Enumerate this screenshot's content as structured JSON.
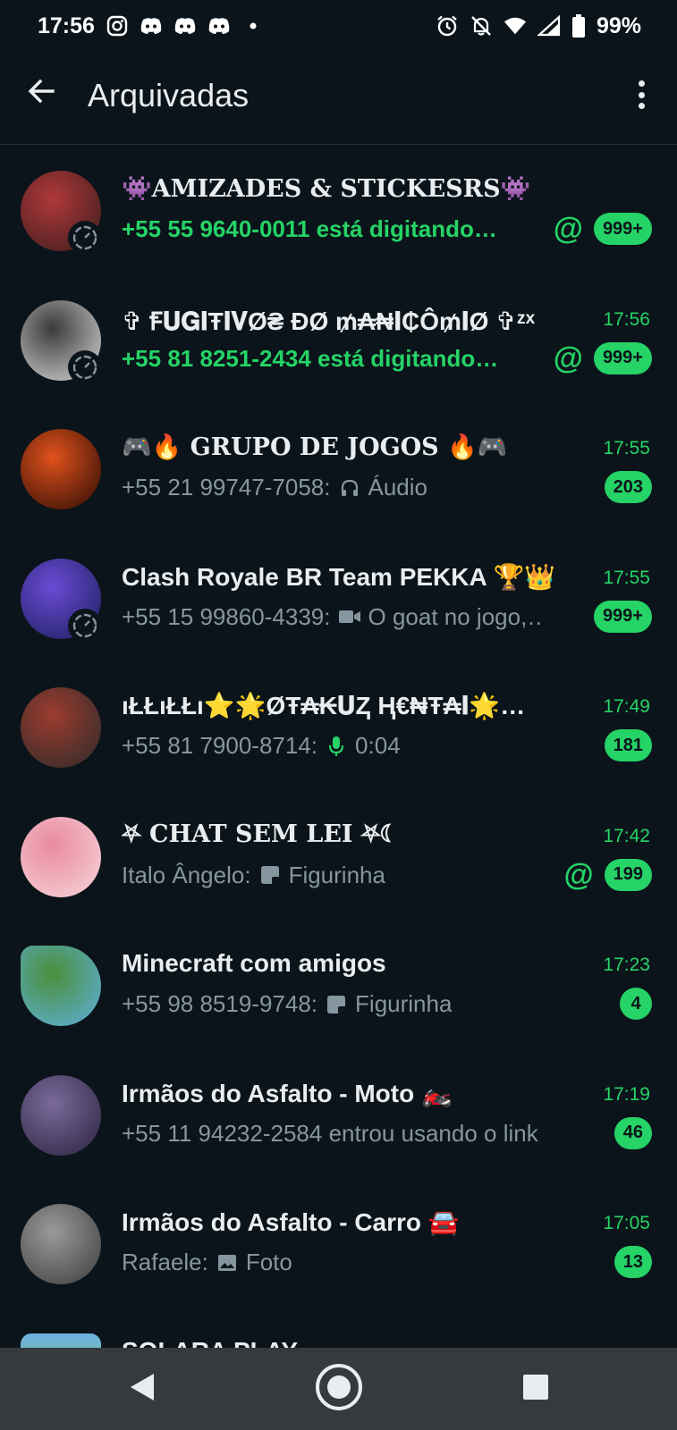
{
  "status_bar": {
    "time": "17:56",
    "battery": "99%",
    "left_icons": [
      "instagram-icon",
      "discord-icon",
      "discord-icon",
      "discord-icon",
      "dot-icon"
    ],
    "right_icons": [
      "alarm-icon",
      "bell-off-icon",
      "wifi-icon",
      "signal-icon",
      "battery-icon"
    ]
  },
  "app_bar": {
    "title": "Arquivadas",
    "back_icon": "arrow-left-icon",
    "menu_icon": "more-vertical-icon"
  },
  "colors": {
    "background": "#0b141a",
    "accent": "#25d366",
    "text_primary": "#e9edef",
    "text_secondary": "#8696a0",
    "nav_bar": "#373a3d"
  },
  "chats": [
    {
      "title": "👾AMIZADES & STICKESRS👾",
      "time": "",
      "preview_prefix": "",
      "preview_icon": "",
      "preview": "+55 55 9640-0011 está digitando…",
      "typing": true,
      "mention": true,
      "unread": "999+",
      "status_ring": true,
      "avatar_colors": [
        "#3a1d1d",
        "#b0383a"
      ]
    },
    {
      "title": "✞ Ꞙ𝐔𝐆𝐈Ŧ𝐈𝐕Ø₴ ĐØ ₥₳₦𝐈₵Ô₥𝐈Ø ✞ᶻˣ",
      "time": "17:56",
      "preview_prefix": "",
      "preview_icon": "",
      "preview": "+55 81 8251-2434 está digitando…",
      "typing": true,
      "mention": true,
      "unread": "999+",
      "status_ring": true,
      "avatar_colors": [
        "#d9d9d9",
        "#3b3b3b"
      ]
    },
    {
      "title": "🎮🔥 GRUPO DE JOGOS 🔥🎮",
      "time": "17:55",
      "preview_prefix": "+55 21 99747-7058:",
      "preview_icon": "headphones-icon",
      "preview": "Áudio",
      "typing": false,
      "mention": false,
      "unread": "203",
      "status_ring": false,
      "avatar_colors": [
        "#2a0a05",
        "#e0521b"
      ]
    },
    {
      "title": "Clash Royale BR Team PEKKA 🏆👑",
      "time": "17:55",
      "preview_prefix": "+55 15 99860-4339:",
      "preview_icon": "video-icon",
      "preview": "O goat no jogo,…",
      "typing": false,
      "mention": false,
      "unread": "999+",
      "status_ring": true,
      "avatar_colors": [
        "#1c1e5a",
        "#6a4bd6"
      ]
    },
    {
      "title": "ıŁŁıŁŁı⭐🌟ØŦ₳₭𝐔Ⱬ Ⱨ€₦Ŧ₳𝐈🌟⭐ı…",
      "time": "17:49",
      "preview_prefix": "+55 81 7900-8714:",
      "preview_icon": "mic-icon",
      "preview": "0:04",
      "typing": false,
      "mention": false,
      "unread": "181",
      "status_ring": false,
      "avatar_colors": [
        "#2b2b2b",
        "#9c3b2e"
      ]
    },
    {
      "title": "⛧ CHAT SEM LEI ⛧☾",
      "time": "17:42",
      "preview_prefix": "Italo Ângelo:",
      "preview_icon": "sticker-icon",
      "preview": "Figurinha",
      "typing": false,
      "mention": true,
      "unread": "199",
      "status_ring": false,
      "avatar_colors": [
        "#f6d6da",
        "#e98aa0"
      ]
    },
    {
      "title": "Minecraft com amigos",
      "time": "17:23",
      "preview_prefix": "+55 98 8519-9748:",
      "preview_icon": "sticker-icon",
      "preview": "Figurinha",
      "typing": false,
      "mention": false,
      "unread": "4",
      "status_ring": false,
      "avatar_colors": [
        "#5fb0e0",
        "#4a8f3a"
      ]
    },
    {
      "title": "Irmãos do Asfalto - Moto 🏍️",
      "time": "17:19",
      "preview_prefix": "",
      "preview_icon": "",
      "preview": "+55 11 94232-2584 entrou usando o link …",
      "typing": false,
      "mention": false,
      "unread": "46",
      "status_ring": false,
      "avatar_colors": [
        "#2a2340",
        "#7a6a9a"
      ]
    },
    {
      "title": "Irmãos do Asfalto - Carro 🚘",
      "time": "17:05",
      "preview_prefix": "Rafaele:",
      "preview_icon": "image-icon",
      "preview": "Foto",
      "typing": false,
      "mention": false,
      "unread": "13",
      "status_ring": false,
      "avatar_colors": [
        "#3c3c3c",
        "#9a9a9a"
      ]
    }
  ],
  "partial_row": {
    "title": "SOLARA PLAY"
  },
  "nav_bar": {
    "back_icon": "nav-back-icon",
    "home_icon": "nav-home-icon",
    "recents_icon": "nav-recents-icon"
  }
}
